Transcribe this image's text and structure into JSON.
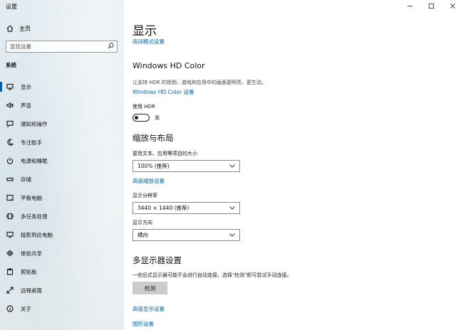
{
  "app": {
    "title": "设置"
  },
  "sidebar": {
    "home_label": "主页",
    "search_placeholder": "查找设置",
    "section": "系统",
    "items": [
      {
        "label": "显示",
        "icon": "monitor-icon",
        "active": true
      },
      {
        "label": "声音",
        "icon": "speaker-icon"
      },
      {
        "label": "通知和操作",
        "icon": "notification-icon"
      },
      {
        "label": "专注助手",
        "icon": "moon-icon"
      },
      {
        "label": "电源和睡眠",
        "icon": "power-icon"
      },
      {
        "label": "存储",
        "icon": "storage-icon"
      },
      {
        "label": "平板电脑",
        "icon": "tablet-icon"
      },
      {
        "label": "多任务处理",
        "icon": "multitask-icon"
      },
      {
        "label": "投影到此电脑",
        "icon": "projection-icon"
      },
      {
        "label": "体验共享",
        "icon": "shared-experience-icon"
      },
      {
        "label": "剪贴板",
        "icon": "clipboard-icon"
      },
      {
        "label": "远程桌面",
        "icon": "remote-desktop-icon"
      },
      {
        "label": "关于",
        "icon": "info-icon"
      }
    ]
  },
  "main": {
    "title": "显示",
    "night_light_link": "夜间模式设置",
    "hdr": {
      "heading": "Windows HD Color",
      "description": "让支持 HDR 的视频、游戏和应用中的画面更明亮、更生动。",
      "settings_link": "Windows HD Color 设置",
      "toggle_label": "使用 HDR",
      "toggle_state": "关",
      "enabled": false
    },
    "scale_layout": {
      "heading": "缩放与布局",
      "scale_label": "更改文本、应用等项目的大小",
      "scale_value": "100% (推荐)",
      "advanced_scaling_link": "高级缩放设置",
      "resolution_label": "显示分辨率",
      "resolution_value": "3440 × 1440 (推荐)",
      "orientation_label": "显示方向",
      "orientation_value": "横向"
    },
    "multi_display": {
      "heading": "多显示器设置",
      "description": "一些旧式显示器可能不会进行自动连接，选择\"检测\"即可尝试手动连接。",
      "detect_button": "检测",
      "advanced_display_link": "高级显示设置",
      "graphics_link": "图形设置"
    }
  },
  "colors": {
    "accent": "#0063b1",
    "link": "#0066b4"
  }
}
